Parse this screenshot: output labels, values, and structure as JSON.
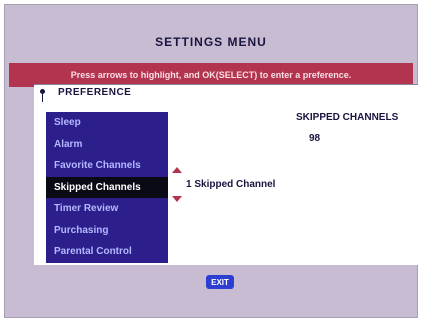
{
  "header": {
    "title": "SETTINGS MENU",
    "instructions": "Press arrows to highlight, and OK(SELECT) to enter a preference."
  },
  "preference": {
    "label": "PREFERENCE",
    "items": [
      {
        "label": "Sleep",
        "selected": false
      },
      {
        "label": "Alarm",
        "selected": false
      },
      {
        "label": "Favorite Channels",
        "selected": false
      },
      {
        "label": "Skipped Channels",
        "selected": true
      },
      {
        "label": "Timer Review",
        "selected": false
      },
      {
        "label": "Purchasing",
        "selected": false
      },
      {
        "label": "Parental Control",
        "selected": false
      }
    ],
    "selected_value": "1 Skipped Channel"
  },
  "detail": {
    "title": "SKIPPED CHANNELS",
    "channel": "98"
  },
  "footer": {
    "exit_label": "EXIT"
  },
  "colors": {
    "background": "#c7bcd1",
    "info_bar": "#b2344f",
    "menu_list": "#2c1f8c",
    "menu_selected": "#0a0a14",
    "exit_button": "#2c3fd0"
  }
}
